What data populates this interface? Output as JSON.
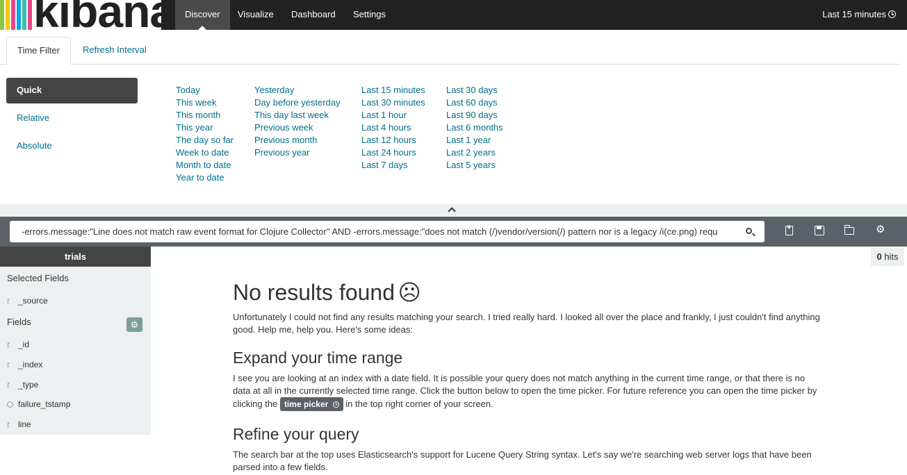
{
  "brand": {
    "name": "kibana",
    "bar_colors": [
      "#e8488b",
      "#3cbeb1",
      "#f2c800",
      "#8cc63f",
      "#00a9e0",
      "#e8488b"
    ]
  },
  "nav": {
    "items": [
      {
        "label": "Discover",
        "active": true
      },
      {
        "label": "Visualize",
        "active": false
      },
      {
        "label": "Dashboard",
        "active": false
      },
      {
        "label": "Settings",
        "active": false
      }
    ],
    "time_label": "Last 15 minutes"
  },
  "timefilter": {
    "tabs": [
      {
        "label": "Time Filter",
        "active": true
      },
      {
        "label": "Refresh Interval",
        "active": false
      }
    ],
    "modes": [
      {
        "label": "Quick",
        "active": true
      },
      {
        "label": "Relative",
        "active": false
      },
      {
        "label": "Absolute",
        "active": false
      }
    ],
    "quick_columns": [
      [
        "Today",
        "This week",
        "This month",
        "This year",
        "The day so far",
        "Week to date",
        "Month to date",
        "Year to date"
      ],
      [
        "Yesterday",
        "Day before yesterday",
        "This day last week",
        "Previous week",
        "Previous month",
        "Previous year"
      ],
      [
        "Last 15 minutes",
        "Last 30 minutes",
        "Last 1 hour",
        "Last 4 hours",
        "Last 12 hours",
        "Last 24 hours",
        "Last 7 days"
      ],
      [
        "Last 30 days",
        "Last 60 days",
        "Last 90 days",
        "Last 6 months",
        "Last 1 year",
        "Last 2 years",
        "Last 5 years"
      ]
    ]
  },
  "search": {
    "query": "-errors.message:\"Line does not match raw event format for Clojure Collector\" AND -errors.message:\"does not match (/)vendor/version(/) pattern nor is a legacy /i(ce.png) requ"
  },
  "sidebar": {
    "index_name": "trials",
    "selected_header": "Selected Fields",
    "selected_fields": [
      {
        "name": "_source",
        "type": "string"
      }
    ],
    "fields_header": "Fields",
    "fields": [
      {
        "name": "_id",
        "type": "string"
      },
      {
        "name": "_index",
        "type": "string"
      },
      {
        "name": "_type",
        "type": "string"
      },
      {
        "name": "failure_tstamp",
        "type": "date"
      },
      {
        "name": "line",
        "type": "string"
      }
    ],
    "type_glyph": "t"
  },
  "hits": {
    "count": "0",
    "label": "hits"
  },
  "results": {
    "title": "No results found",
    "emoji": "☹",
    "intro": "Unfortunately I could not find any results matching your search. I tried really hard. I looked all over the place and frankly, I just couldn't find anything good. Help me, help you. Here's some ideas:",
    "expand_title": "Expand your time range",
    "expand_text_1": "I see you are looking at an index with a date field. It is possible your query does not match anything in the current time range, or that there is no data at all in the currently selected time range. Click the button below to open the time picker. For future reference you can open the time picker by clicking the",
    "time_picker_label": "time picker",
    "expand_text_2": "in the top right corner of your screen.",
    "refine_title": "Refine your query",
    "refine_text": "The search bar at the top uses Elasticsearch's support for Lucene Query String syntax. Let's say we're searching web server logs that have been parsed into a few fields."
  }
}
